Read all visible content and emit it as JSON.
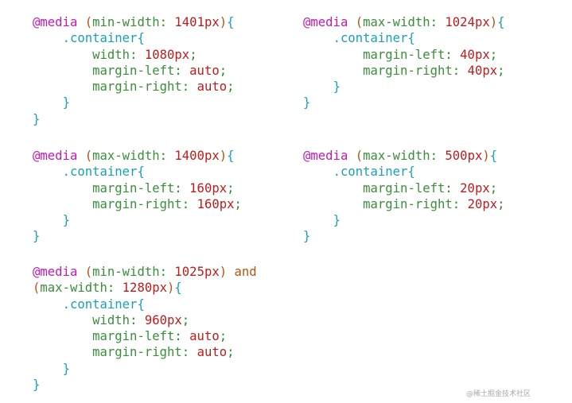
{
  "blocks": [
    {
      "lines": [
        [
          "@media",
          " ",
          "(",
          "min-width",
          ": ",
          "1401px",
          ")",
          "{"
        ],
        [
          "    ",
          ".container",
          "{"
        ],
        [
          "        ",
          "width",
          ": ",
          "1080px",
          ";"
        ],
        [
          "        ",
          "margin-left",
          ": ",
          "auto",
          ";"
        ],
        [
          "        ",
          "margin-right",
          ": ",
          "auto",
          ";"
        ],
        [
          "    ",
          "}"
        ],
        [
          "}"
        ]
      ]
    },
    {
      "lines": [
        [
          "@media",
          " ",
          "(",
          "max-width",
          ": ",
          "1024px",
          ")",
          "{"
        ],
        [
          "    ",
          ".container",
          "{"
        ],
        [
          "        ",
          "margin-left",
          ": ",
          "40px",
          ";"
        ],
        [
          "        ",
          "margin-right",
          ": ",
          "40px",
          ";"
        ],
        [
          "    ",
          "}"
        ],
        [
          "}"
        ]
      ]
    },
    {
      "lines": [
        [
          "@media",
          " ",
          "(",
          "max-width",
          ": ",
          "1400px",
          ")",
          "{"
        ],
        [
          "    ",
          ".container",
          "{"
        ],
        [
          "        ",
          "margin-left",
          ": ",
          "160px",
          ";"
        ],
        [
          "        ",
          "margin-right",
          ": ",
          "160px",
          ";"
        ],
        [
          "    ",
          "}"
        ],
        [
          "}"
        ]
      ]
    },
    {
      "lines": [
        [
          "@media",
          " ",
          "(",
          "max-width",
          ": ",
          "500px",
          ")",
          "{"
        ],
        [
          "    ",
          ".container",
          "{"
        ],
        [
          "        ",
          "margin-left",
          ": ",
          "20px",
          ";"
        ],
        [
          "        ",
          "margin-right",
          ": ",
          "20px",
          ";"
        ],
        [
          "    ",
          "}"
        ],
        [
          "}"
        ]
      ]
    },
    {
      "lines": [
        [
          "@media",
          " ",
          "(",
          "min-width",
          ": ",
          "1025px",
          ")",
          " ",
          "and"
        ],
        [
          "(",
          "max-width",
          ": ",
          "1280px",
          ")",
          "{"
        ],
        [
          "    ",
          ".container",
          "{"
        ],
        [
          "        ",
          "width",
          ": ",
          "960px",
          ";"
        ],
        [
          "        ",
          "margin-left",
          ": ",
          "auto",
          ";"
        ],
        [
          "        ",
          "margin-right",
          ": ",
          "auto",
          ";"
        ],
        [
          "    ",
          "}"
        ],
        [
          "}"
        ]
      ]
    }
  ],
  "watermark": "@稀土掘金技术社区"
}
